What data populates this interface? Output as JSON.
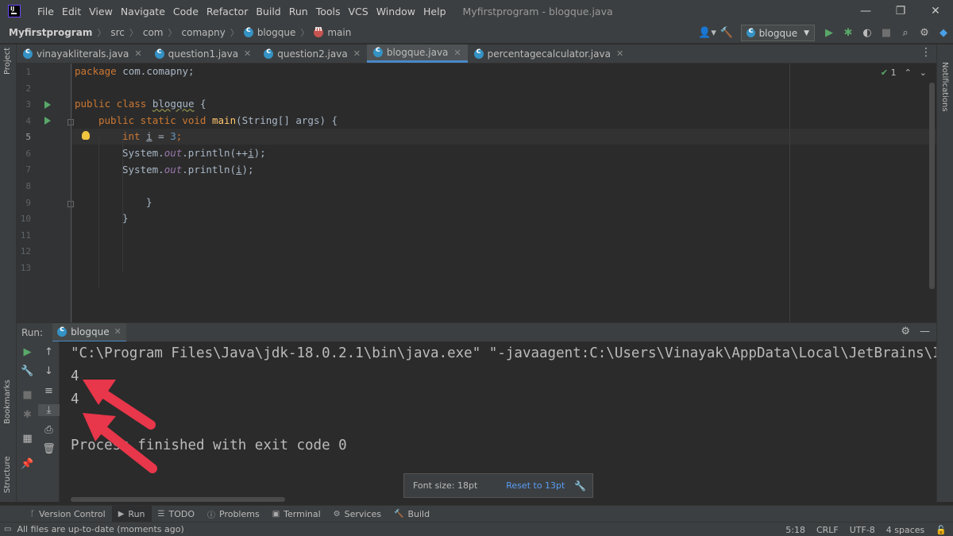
{
  "window": {
    "title": "Myfirstprogram - blogque.java",
    "controls": {
      "minimize": "—",
      "maximize": "❐",
      "close": "✕"
    }
  },
  "menu": [
    "File",
    "Edit",
    "View",
    "Navigate",
    "Code",
    "Refactor",
    "Build",
    "Run",
    "Tools",
    "VCS",
    "Window",
    "Help"
  ],
  "breadcrumb": {
    "project": "Myfirstprogram",
    "items": [
      "src",
      "com",
      "comapny",
      "blogque",
      "main"
    ]
  },
  "toolbar": {
    "run_config": "blogque"
  },
  "left_strip": {
    "project": "Project",
    "bookmarks": "Bookmarks",
    "structure": "Structure"
  },
  "right_strip": {
    "notifications": "Notifications"
  },
  "tabs": [
    {
      "label": "vinayakliterals.java"
    },
    {
      "label": "question1.java"
    },
    {
      "label": "question2.java"
    },
    {
      "label": "blogque.java"
    },
    {
      "label": "percentagecalculator.java"
    }
  ],
  "editor": {
    "line_numbers": [
      "1",
      "2",
      "3",
      "4",
      "5",
      "6",
      "7",
      "8",
      "9",
      "10",
      "11",
      "12",
      "13"
    ],
    "current_line": "5",
    "inspection_count": "1",
    "code": {
      "l1_kw": "package",
      "l1_rest": " com.comapny;",
      "l3_kw": "public class",
      "l3_name": "blogque",
      "l3_rest": " {",
      "l4_kw": "public static void",
      "l4_fn": "main",
      "l4_rest": "(String[] args) {",
      "l5_kw": "int",
      "l5_var": "i",
      "l5_eq": " = ",
      "l5_num": "3",
      "l5_end": ";",
      "l6_a": "System.",
      "l6_fld": "out",
      "l6_b": ".println(++",
      "l6_var": "i",
      "l6_c": ");",
      "l7_a": "System.",
      "l7_fld": "out",
      "l7_b": ".println(",
      "l7_var": "i",
      "l7_c": ");",
      "l9": "}",
      "l10": "}"
    }
  },
  "run_panel": {
    "label": "Run:",
    "tab": "blogque",
    "console": [
      "\"C:\\Program Files\\Java\\jdk-18.0.2.1\\bin\\java.exe\" \"-javaagent:C:\\Users\\Vinayak\\AppData\\Local\\JetBrains\\Intell",
      "4",
      "4",
      "",
      "Process finished with exit code 0"
    ]
  },
  "toast": {
    "text": "Font size: 18pt",
    "link": "Reset to 13pt"
  },
  "bottom_tools": [
    {
      "label": "Version Control",
      "icon": "version-control-icon"
    },
    {
      "label": "Run",
      "icon": "run-icon"
    },
    {
      "label": "TODO",
      "icon": "todo-icon"
    },
    {
      "label": "Problems",
      "icon": "problems-icon"
    },
    {
      "label": "Terminal",
      "icon": "terminal-icon"
    },
    {
      "label": "Services",
      "icon": "services-icon"
    },
    {
      "label": "Build",
      "icon": "build-icon"
    }
  ],
  "status": {
    "message": "All files are up-to-date (moments ago)",
    "position": "5:18",
    "line_sep": "CRLF",
    "encoding": "UTF-8",
    "indent": "4 spaces"
  },
  "colors": {
    "accent": "#4a88c7",
    "run_green": "#59a869",
    "arrow_red": "#e8364a"
  }
}
